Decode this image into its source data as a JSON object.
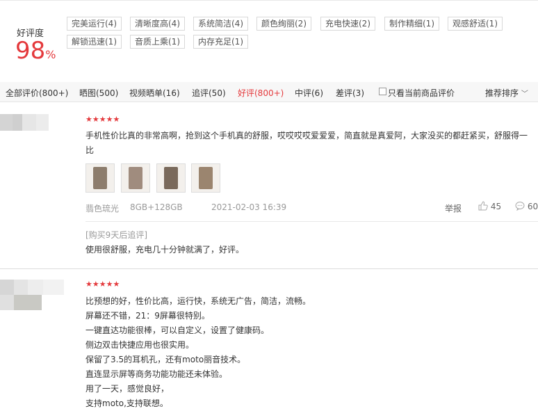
{
  "summary": {
    "label": "好评度",
    "score": "98",
    "unit": "%",
    "tags": [
      "完美运行(4)",
      "清晰度高(4)",
      "系统简洁(4)",
      "颜色绚丽(2)",
      "充电快速(2)",
      "制作精细(1)",
      "观感舒适(1)",
      "解锁迅速(1)",
      "音质上乘(1)",
      "内存充足(1)"
    ]
  },
  "filters": [
    "全部评价(800+)",
    "晒图(500)",
    "视频晒单(16)",
    "追评(50)",
    "好评(800+)",
    "中评(6)",
    "差评(3)",
    "只看当前商品评价",
    "推荐排序"
  ],
  "icons": {
    "sort": "chevron-down-icon",
    "like": "thumb-up-icon",
    "reply": "comment-icon",
    "rating": "star-icon"
  },
  "colors": {
    "accent": "#e4393c",
    "muted": "#999999"
  },
  "reviews": [
    {
      "stars": "★★★★★",
      "text": "手机性价比真的非常高啊，抢到这个手机真的舒服，哎哎哎哎爱爱爱，简直就是真爱阿，大家没买的都赶紧买，舒服得一比",
      "color": "翡色琉光",
      "spec": "8GB+128GB",
      "date": "2021-02-03 16:39",
      "report": "举报",
      "likes": "45",
      "replies": "60",
      "followup_label": "[购买9天后追评]",
      "followup": "使用很舒服，充电几十分钟就满了，好评。"
    },
    {
      "stars": "★★★★★",
      "lines": [
        "比预想的好，性价比高，运行快，系统无广告，简洁，流畅。",
        "屏幕还不错，21：9屏幕很特别。",
        "一键直达功能很棒，可以自定义，设置了健康码。",
        "侧边双击快捷应用也很实用。",
        "保留了3.5的耳机孔，还有moto丽音技术。",
        "直连显示屏等商务功能功能还未体验。",
        "用了一天，感觉良好，",
        "支持moto,支持联想。"
      ]
    }
  ]
}
